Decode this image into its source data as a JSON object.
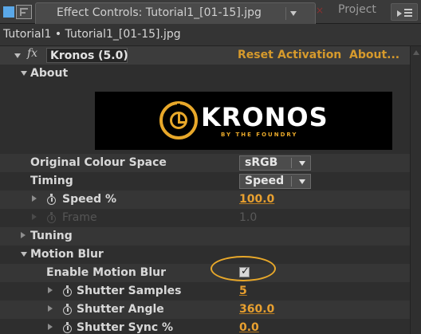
{
  "tab": {
    "title": "Effect Controls: Tutorial1_[01-15].jpg",
    "close_glyph": "×",
    "project_label": "Project"
  },
  "breadcrumb": "Tutorial1 • Tutorial1_[01-15].jpg",
  "effect": {
    "fx_badge": "fx",
    "name": "Kronos (5.0)",
    "reset": "Reset",
    "activation": "Activation",
    "about": "About..."
  },
  "about": {
    "label": "About"
  },
  "logo": {
    "word": "KRONOS",
    "sub": "BY THE FOUNDRY"
  },
  "params": {
    "colour_space": {
      "label": "Original Colour Space",
      "value": "sRGB"
    },
    "timing": {
      "label": "Timing",
      "value": "Speed"
    },
    "speed": {
      "label": "Speed %",
      "value": "100.0"
    },
    "frame": {
      "label": "Frame",
      "value": "1.0"
    },
    "tuning": {
      "label": "Tuning"
    },
    "motion_blur": {
      "label": "Motion Blur"
    },
    "enable_motion_blur": {
      "label": "Enable Motion Blur",
      "checked": true
    },
    "shutter_samples": {
      "label": "Shutter Samples",
      "value": "5"
    },
    "shutter_angle": {
      "label": "Shutter Angle",
      "value": "360.0"
    },
    "shutter_sync": {
      "label": "Shutter Sync %",
      "value": "0.0"
    }
  },
  "icons": {
    "stopwatch": "stopwatch-icon",
    "checkmark": "✓"
  },
  "colors": {
    "accent_orange": "#e8a030",
    "panel_bg": "#2b2b2b",
    "highlight": "#e8a82a",
    "tab_blue": "#5aa8e8"
  }
}
